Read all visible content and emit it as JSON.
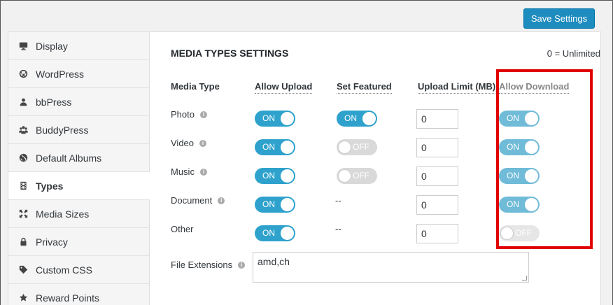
{
  "toolbar": {
    "save_label": "Save Settings"
  },
  "sidebar": {
    "items": [
      {
        "label": "Display",
        "icon": "monitor-icon"
      },
      {
        "label": "WordPress",
        "icon": "wordpress-icon"
      },
      {
        "label": "bbPress",
        "icon": "person-icon"
      },
      {
        "label": "BuddyPress",
        "icon": "group-icon"
      },
      {
        "label": "Default Albums",
        "icon": "globe-icon"
      },
      {
        "label": "Types",
        "icon": "film-icon",
        "active": true
      },
      {
        "label": "Media Sizes",
        "icon": "resize-icon"
      },
      {
        "label": "Privacy",
        "icon": "lock-icon"
      },
      {
        "label": "Custom CSS",
        "icon": "tag-icon"
      },
      {
        "label": "Reward Points",
        "icon": "star-icon"
      }
    ]
  },
  "main": {
    "title": "MEDIA TYPES SETTINGS",
    "limit_note": "0 = Unlimited",
    "columns": {
      "media_type": "Media Type",
      "allow_upload": "Allow Upload",
      "set_featured": "Set Featured",
      "upload_limit": "Upload Limit (MB)",
      "allow_download": "Allow Download"
    },
    "rows": [
      {
        "type": "Photo",
        "allow_upload": "ON",
        "set_featured": "ON",
        "limit": "0",
        "allow_download": "ON"
      },
      {
        "type": "Video",
        "allow_upload": "ON",
        "set_featured": "OFF",
        "limit": "0",
        "allow_download": "ON"
      },
      {
        "type": "Music",
        "allow_upload": "ON",
        "set_featured": "OFF",
        "limit": "0",
        "allow_download": "ON"
      },
      {
        "type": "Document",
        "allow_upload": "ON",
        "set_featured": "--",
        "limit": "0",
        "allow_download": "ON"
      },
      {
        "type": "Other",
        "allow_upload": "ON",
        "set_featured": "--",
        "limit": "0",
        "allow_download": "OFF"
      }
    ],
    "file_extensions_label": "File Extensions",
    "file_extensions_value": "amd,ch",
    "info_glyph": "i"
  },
  "colors": {
    "accent": "#2ea2cc",
    "button": "#1e8cbe",
    "highlight": "#e00000"
  }
}
